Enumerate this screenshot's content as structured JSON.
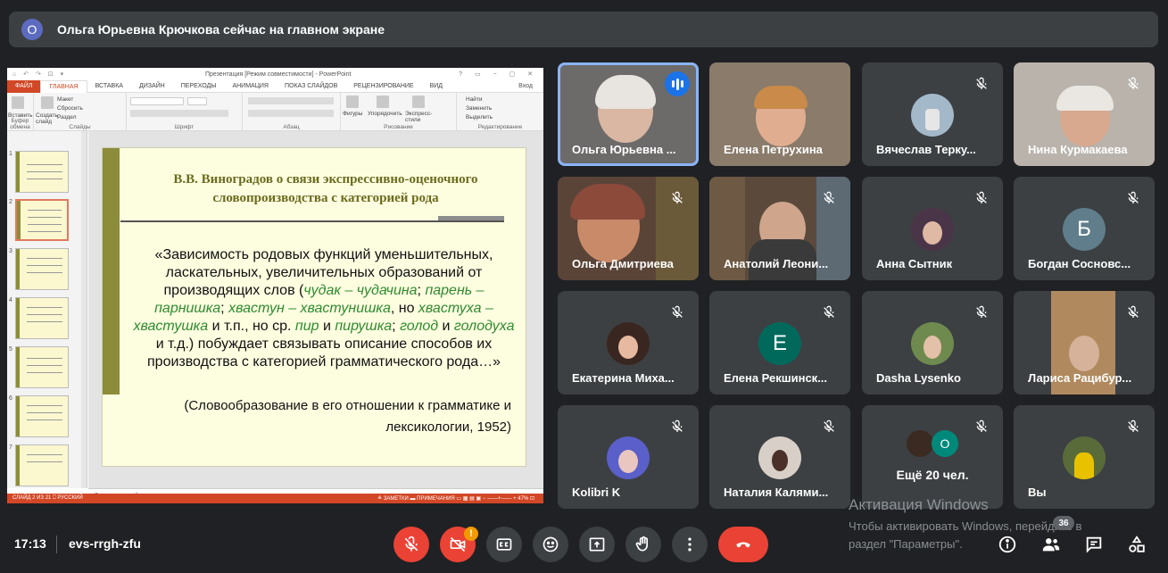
{
  "banner": {
    "avatar_letter": "О",
    "text": "Ольга Юрьевна Крючкова сейчас на главном экране"
  },
  "presentation": {
    "window_title": "Презентация [Режим совместимости] - PowerPoint",
    "quick_access": "⌂ ↶ ↷ ⊡ ▾",
    "window_controls": "? ▭ − ▢ ✕",
    "tabs": [
      "ФАЙЛ",
      "ГЛАВНАЯ",
      "ВСТАВКА",
      "ДИЗАЙН",
      "ПЕРЕХОДЫ",
      "АНИМАЦИЯ",
      "ПОКАЗ СЛАЙДОВ",
      "РЕЦЕНЗИРОВАНИЕ",
      "ВИД"
    ],
    "user": "Вход",
    "ribbon": {
      "paste": "Вставить",
      "create_slide": "Создать слайд",
      "layout": "Макет",
      "reset": "Сбросить",
      "section": "Раздел",
      "shapes": "Фигуры",
      "arrange": "Упорядочить",
      "quick_styles": "Экспресс-стили",
      "find": "Найти",
      "replace": "Заменить",
      "select": "Выделить",
      "groups": [
        "Буфер обмена",
        "Слайды",
        "Шрифт",
        "Абзац",
        "Рисование",
        "Редактирование"
      ]
    },
    "slide_numbers": [
      "1",
      "2",
      "3",
      "4",
      "5",
      "6",
      "7"
    ],
    "slide": {
      "title": "В.В. Виноградов о связи экспрессивно-оценочного словопроизводства с категорией рода",
      "q1": "«Зависимость родовых функций уменьшительных, ласкательных, увеличительных образований от производящих слов (",
      "w1": "чудак – чудачина",
      "s1": "; ",
      "w2": "парень – парнишка",
      "s2": "; ",
      "w3": "хвастун – хвастунишка",
      "s3": ", но ",
      "w4": "хвастуха – хвастушка",
      "s4": " и т.п., но ср. ",
      "w5": "пир",
      "s5": " и ",
      "w6": "пирушка",
      "s6": "; ",
      "w7": "голод",
      "s7": " и ",
      "w8": "голодуха",
      "q2": " и т.д.) побуждает связывать описание способов их производства с категорией грамматического рода…»",
      "ref": "(Словообразование в его отношении к грамматике и лексикологии, 1952)"
    },
    "notes_placeholder": "Заметки к слайду",
    "status_left": "СЛАЙД 2 ИЗ 21   ⎕   РУССКИЙ",
    "status_right": "≙ ЗАМЕТКИ   ▬ ПРИМЕЧАНИЯ   ▭ ▦ ▤ ▣  − ——+—— +  47%  ⊡"
  },
  "participants": [
    {
      "name": "Ольга Юрьевна ...",
      "type": "video",
      "speaking": true,
      "muted": false
    },
    {
      "name": "Елена Петрухина",
      "type": "video",
      "muted": false
    },
    {
      "name": "Вячеслав Терку...",
      "type": "avatar",
      "muted": true
    },
    {
      "name": "Нина Курмакаева",
      "type": "video",
      "muted": true
    },
    {
      "name": "Ольга Дмитриева",
      "type": "video",
      "muted": true
    },
    {
      "name": "Анатолий Леони...",
      "type": "video",
      "muted": true
    },
    {
      "name": "Анна Сытник",
      "type": "avatar",
      "muted": true
    },
    {
      "name": "Богдан Сосновс...",
      "type": "letter",
      "letter": "Б",
      "color": "#607d8b",
      "muted": true
    },
    {
      "name": "Екатерина Миха...",
      "type": "avatar",
      "muted": true
    },
    {
      "name": "Елена Рекшинск...",
      "type": "letter",
      "letter": "Е",
      "color": "#00695c",
      "muted": true
    },
    {
      "name": "Dasha Lysenko",
      "type": "avatar",
      "muted": true
    },
    {
      "name": "Лариса Рацибур...",
      "type": "video",
      "muted": true
    },
    {
      "name": "Kolibri K",
      "type": "avatar",
      "muted": true
    },
    {
      "name": "Наталия Калями...",
      "type": "avatar",
      "muted": true
    },
    {
      "name": "",
      "type": "more",
      "more_text": "Ещё 20 чел.",
      "more_letter": "О",
      "muted": true
    },
    {
      "name": "Вы",
      "type": "avatar",
      "muted": true
    }
  ],
  "watermark": {
    "line1": "Активация Windows",
    "line2": "Чтобы активировать Windows, перейдите в",
    "line3": "раздел \"Параметры\"."
  },
  "footer": {
    "time": "17:13",
    "meeting_code": "evs-rrgh-zfu",
    "participants_count": "36",
    "warn": "!"
  },
  "colors": {
    "end_call": "#ea4335",
    "accent": "#8ab4f8",
    "ppt_orange": "#d24726"
  }
}
